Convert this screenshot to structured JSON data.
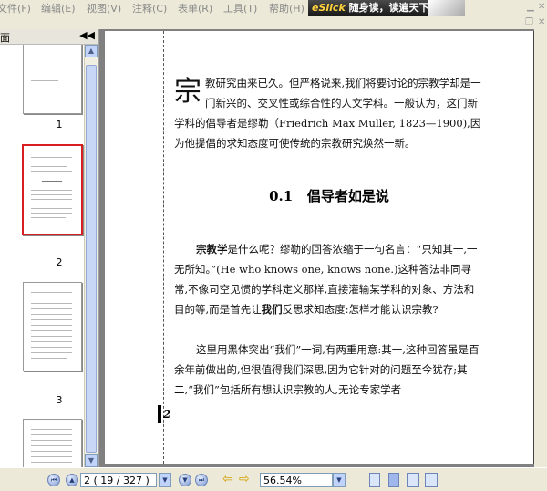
{
  "menu": {
    "items": [
      {
        "label": "文件(F)",
        "key": "file"
      },
      {
        "label": "编辑(E)",
        "key": "edit"
      },
      {
        "label": "视图(V)",
        "key": "view"
      },
      {
        "label": "注释(C)",
        "key": "comment"
      },
      {
        "label": "表单(R)",
        "key": "form"
      },
      {
        "label": "工具(T)",
        "key": "tools"
      },
      {
        "label": "帮助(H)",
        "key": "help"
      }
    ]
  },
  "banner": {
    "brand": "eSlick",
    "text": "随身读，读遍天下书！"
  },
  "sidebar": {
    "title": "面",
    "collapse": "◀◀",
    "thumbnails": [
      {
        "number": "1"
      },
      {
        "number": "2"
      },
      {
        "number": "3"
      }
    ]
  },
  "document": {
    "dropcap": "宗",
    "intro": "教研究由来已久。但严格说来,我们将要讨论的宗教学却是一门新兴的、交叉性或综合性的人文学科。一般认为，这门新学科的倡导者是缪勒（Friedrich Max Muller, 1823—1900),因为他提倡的求知态度可使传统的宗教研究焕然一新。",
    "section_number": "0.1",
    "section_title": "倡导者如是说",
    "para1_bold": "宗教学",
    "para1_a": "是什么呢？缪勒的回答浓缩于一句名言：“只知其一,一无所知。”(He who knows one, knows none.)这种答法非同寻常,不像司空见惯的学科定义那样,直接灌输某学科的对象、方法和目的等,而是首先让",
    "para1_bold2": "我们",
    "para1_b": "反思求知态度:怎样才能认识宗教?",
    "para2": "这里用黑体突出“我们”一词,有两重用意:其一,这种回答虽是百余年前做出的,但很值得我们深思,因为它针对的问题至今犹存;其二,“我们”包括所有想认识宗教的人,无论专家学者",
    "page_number": "2"
  },
  "statusbar": {
    "page_field": "2 ( 19 / 327 )",
    "zoom": "56.54%"
  }
}
